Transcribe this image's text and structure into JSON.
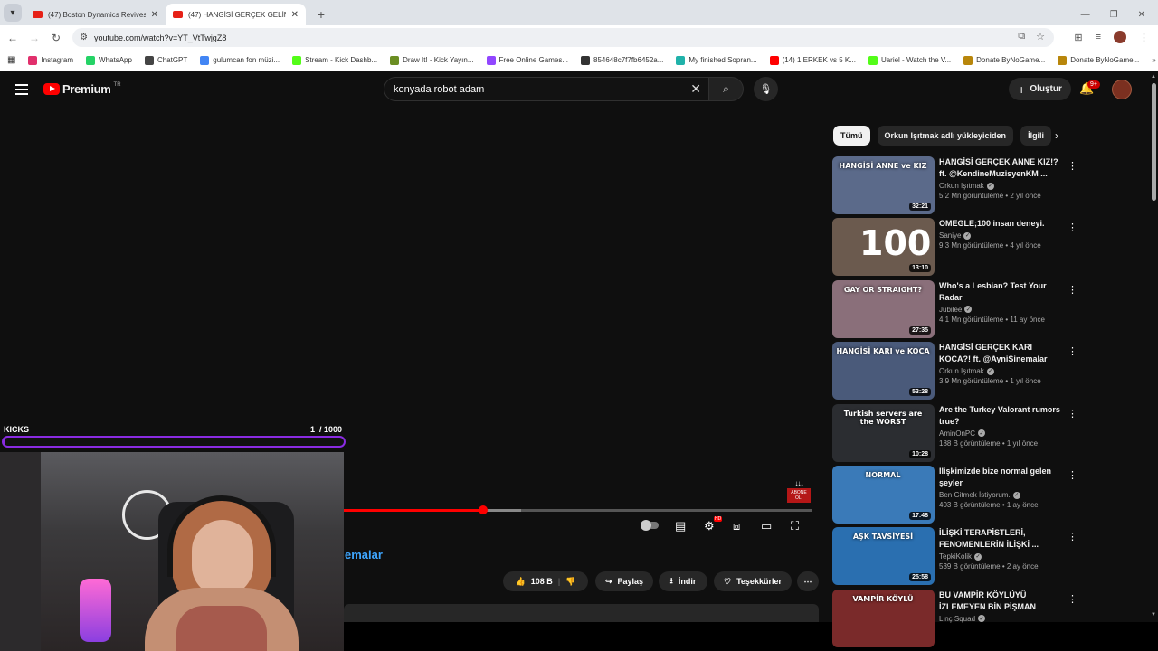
{
  "browser": {
    "tabs": [
      {
        "title": "(47) Boston Dynamics Revives A",
        "active": false
      },
      {
        "title": "(47) HANGİSİ GERÇEK GELİN KA",
        "active": true
      }
    ],
    "url": "youtube.com/watch?v=YT_VtTwjgZ8",
    "bookmarks": [
      {
        "label": "Instagram",
        "color": "#e1306c"
      },
      {
        "label": "WhatsApp",
        "color": "#25d366"
      },
      {
        "label": "ChatGPT",
        "color": "#444444"
      },
      {
        "label": "gulumcan fon müzi...",
        "color": "#4285f4"
      },
      {
        "label": "Stream - Kick Dashb...",
        "color": "#53fc18"
      },
      {
        "label": "Draw It! - Kick Yayın...",
        "color": "#6b8e23"
      },
      {
        "label": "Free Online Games...",
        "color": "#9146ff"
      },
      {
        "label": "854648c7f7fb6452a...",
        "color": "#333333"
      },
      {
        "label": "My finished Sopran...",
        "color": "#20b2aa"
      },
      {
        "label": "(14) 1 ERKEK vs 5 K...",
        "color": "#ff0000"
      },
      {
        "label": "Uariel - Watch the V...",
        "color": "#53fc18"
      },
      {
        "label": "Donate ByNoGame...",
        "color": "#b8860b"
      },
      {
        "label": "Donate ByNoGame...",
        "color": "#b8860b"
      }
    ]
  },
  "youtube": {
    "logo": "Premium",
    "country": "TR",
    "search_value": "konyada robot adam",
    "create_label": "Oluştur",
    "notif_badge": "9+",
    "chips": [
      {
        "label": "Tümü",
        "active": true
      },
      {
        "label": "Orkun Işıtmak adlı yükleyiciden",
        "active": false
      },
      {
        "label": "İlgili",
        "active": false
      }
    ]
  },
  "player": {
    "progress_fraction": 0.297,
    "buffer_fraction": 0.378,
    "channel_fragment": "emalar",
    "sticker_label": "ABONE OL!",
    "actions": {
      "likes": "108 B",
      "share": "Paylaş",
      "download": "İndir",
      "thanks": "Teşekkürler"
    }
  },
  "overlay": {
    "kicks_label": "KICKS",
    "kicks_current": "1",
    "kicks_goal": "/ 1000",
    "kicks_fraction": 0.001
  },
  "recommendations": [
    {
      "title": "HANGİSİ GERÇEK ANNE KIZ!? ft. @KendineMuzisyenKM ...",
      "channel": "Orkun Işıtmak",
      "stats": "5,2 Mn görüntüleme • 2 yıl önce",
      "duration": "32:21",
      "thumb_text": "HANGİSİ ANNE ve KIZ",
      "bg": "#5b6a8a"
    },
    {
      "title": "OMEGLE;100 insan deneyi.",
      "channel": "Saniye",
      "stats": "9,3 Mn görüntüleme • 4 yıl önce",
      "duration": "13:10",
      "thumb_text": "100",
      "bg": "#6b5a4e"
    },
    {
      "title": "Who's a Lesbian? Test Your Radar",
      "channel": "Jubilee",
      "stats": "4,1 Mn görüntüleme • 11 ay önce",
      "duration": "27:35",
      "thumb_text": "GAY OR STRAIGHT?",
      "bg": "#8a6f7a"
    },
    {
      "title": "HANGİSİ GERÇEK KARI KOCA?! ft. @AyniSinemalar",
      "channel": "Orkun Işıtmak",
      "stats": "3,9 Mn görüntüleme • 1 yıl önce",
      "duration": "53:28",
      "thumb_text": "HANGİSİ KARI ve KOCA",
      "bg": "#4a5a7a"
    },
    {
      "title": "Are the Turkey Valorant rumors true?",
      "channel": "AminOnPC",
      "stats": "188 B görüntüleme • 1 yıl önce",
      "duration": "10:28",
      "thumb_text": "Turkish servers are the WORST",
      "bg": "#2b2d31"
    },
    {
      "title": "İlişkimizde bize normal gelen şeyler",
      "channel": "Ben Gitmek İstiyorum.",
      "stats": "403 B görüntüleme • 1 ay önce",
      "duration": "17:48",
      "thumb_text": "NORMAL",
      "bg": "#3a7ab8"
    },
    {
      "title": "İLİŞKİ TERAPİSTLERİ, FENOMENLERİN İLİŞKİ ...",
      "channel": "TepkiKolik",
      "stats": "539 B görüntüleme • 2 ay önce",
      "duration": "25:58",
      "thumb_text": "AŞK TAVSİYESİ",
      "bg": "#2a6fb0"
    },
    {
      "title": "BU VAMPİR KÖYLÜYÜ İZLEMEYEN BİN PİŞMAN",
      "channel": "Linç Squad",
      "stats": "",
      "duration": "",
      "thumb_text": "VAMPİR KÖYLÜ",
      "bg": "#7a2a2a"
    }
  ]
}
